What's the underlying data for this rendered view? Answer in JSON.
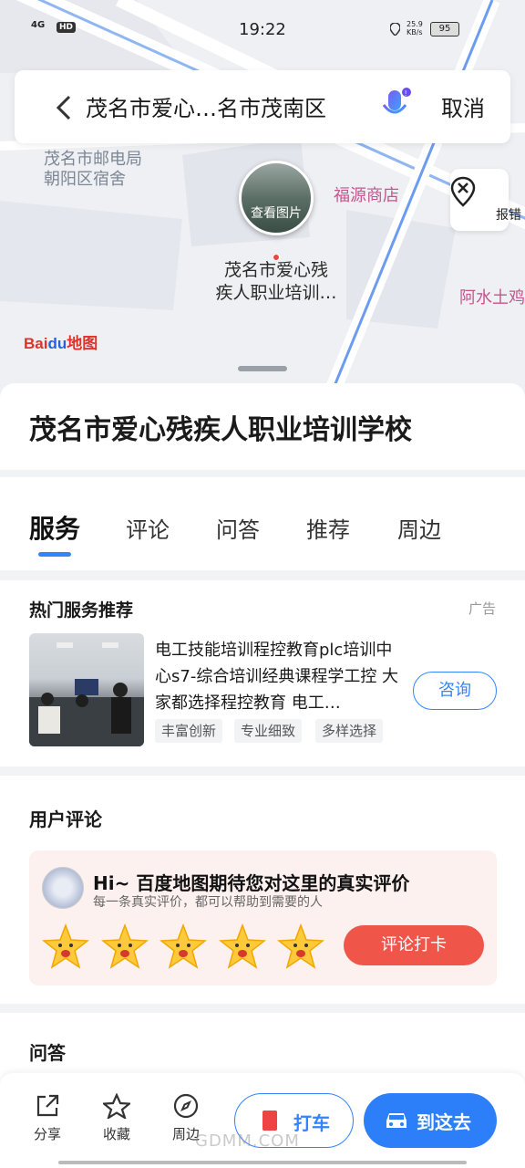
{
  "status_bar": {
    "network": "4G",
    "hd": "HD",
    "time": "19:22",
    "speed_value": "25.9",
    "speed_unit": "KB/s",
    "battery": "95"
  },
  "search": {
    "query": "茂名市爱心…名市茂南区",
    "cancel_label": "取消"
  },
  "map": {
    "labels": {
      "post_office": "茂名市邮电局\n朝阳区宿舍",
      "shop": "福源商店",
      "water": "阿水土鸡"
    },
    "pin": {
      "photo_label": "查看图片",
      "name": "茂名市爱心残\n疾人职业培训…"
    },
    "report_label": "报错",
    "logo_bai": "Bai",
    "logo_du": "du",
    "logo_map": "地图"
  },
  "place": {
    "title": "茂名市爱心残疾人职业培训学校"
  },
  "tabs": [
    {
      "label": "服务",
      "active": true
    },
    {
      "label": "评论"
    },
    {
      "label": "问答"
    },
    {
      "label": "推荐"
    },
    {
      "label": "周边"
    }
  ],
  "services": {
    "header": "热门服务推荐",
    "ad_label": "广告",
    "description": "电工技能培训程控教育plc培训中心s7-综合培训经典课程学工控 大家都选择程控教育 电工…",
    "tags": [
      "丰富创新",
      "专业细致",
      "多样选择"
    ],
    "consult_label": "咨询"
  },
  "reviews": {
    "header": "用户评论",
    "greeting": "Hi~ 百度地图期待您对这里的真实评价",
    "subtitle": "每一条真实评价，都可以帮助到需要的人",
    "stars_count": 5,
    "button": "评论打卡"
  },
  "qa": {
    "header": "问答"
  },
  "bottom_bar": {
    "share": "分享",
    "favorite": "收藏",
    "nearby": "周边",
    "taxi": "打车",
    "go": "到这去"
  },
  "watermark": "GDMM.COM",
  "colors": {
    "accent": "#3385ff",
    "review_button": "#f0554a",
    "go_button": "#2d7ff9"
  }
}
